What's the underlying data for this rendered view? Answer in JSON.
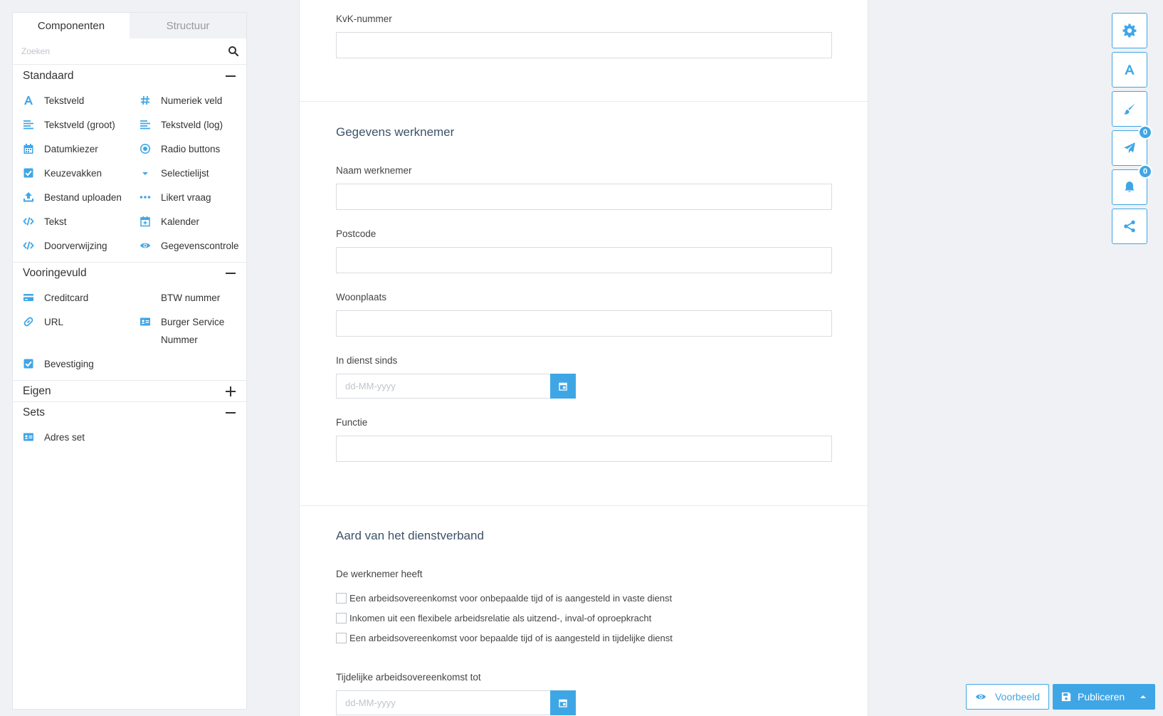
{
  "sidebar": {
    "tabs": [
      {
        "label": "Componenten",
        "active": true
      },
      {
        "label": "Structuur",
        "active": false
      }
    ],
    "search_placeholder": "Zoeken",
    "sections": {
      "standaard": {
        "title": "Standaard",
        "items": [
          {
            "label": "Tekstveld",
            "icon": "font-icon"
          },
          {
            "label": "Numeriek veld",
            "icon": "hash-icon"
          },
          {
            "label": "Tekstveld (groot)",
            "icon": "align-left-icon"
          },
          {
            "label": "Tekstveld (log)",
            "icon": "align-left-icon"
          },
          {
            "label": "Datumkiezer",
            "icon": "calendar-icon"
          },
          {
            "label": "Radio buttons",
            "icon": "radio-icon"
          },
          {
            "label": "Keuzevakken",
            "icon": "checkbox-icon"
          },
          {
            "label": "Selectielijst",
            "icon": "caret-down-icon"
          },
          {
            "label": "Bestand uploaden",
            "icon": "upload-icon"
          },
          {
            "label": "Likert vraag",
            "icon": "ellipsis-icon"
          },
          {
            "label": "Tekst",
            "icon": "code-icon"
          },
          {
            "label": "Kalender",
            "icon": "calendar-plus-icon"
          },
          {
            "label": "Doorverwijzing",
            "icon": "code-icon"
          },
          {
            "label": "Gegevenscontrole",
            "icon": "eye-icon"
          }
        ]
      },
      "vooringevuld": {
        "title": "Vooringevuld",
        "items": [
          {
            "label": "Creditcard",
            "icon": "credit-card-icon"
          },
          {
            "label": "BTW nummer",
            "icon": ""
          },
          {
            "label": "URL",
            "icon": "link-icon"
          },
          {
            "label": "Burger Service Nummer",
            "icon": "id-card-icon"
          },
          {
            "label": "Bevestiging",
            "icon": "checkbox-icon"
          }
        ]
      },
      "eigen": {
        "title": "Eigen"
      },
      "sets": {
        "title": "Sets",
        "items": [
          {
            "label": "Adres set",
            "icon": "id-card-icon"
          }
        ]
      }
    }
  },
  "form": {
    "kvk_label": "KvK-nummer",
    "section_werknemer": "Gegevens werknemer",
    "naam_label": "Naam werknemer",
    "postcode_label": "Postcode",
    "woonplaats_label": "Woonplaats",
    "in_dienst_label": "In dienst sinds",
    "date_placeholder": "dd-MM-yyyy",
    "functie_label": "Functie",
    "section_dienstverband": "Aard van het dienstverband",
    "werknemer_heeft_label": "De werknemer heeft",
    "options": [
      "Een arbeidsovereenkomst voor onbepaalde tijd of is aangesteld in vaste dienst",
      "Inkomen uit een flexibele arbeidsrelatie als uitzend-, inval-of oproepkracht",
      "Een arbeidsovereenkomst voor bepaalde tijd of is aangesteld in tijdelijke dienst"
    ],
    "tijdelijk_label": "Tijdelijke arbeidsovereenkomst tot"
  },
  "toolbar": {
    "send_badge": "0",
    "notify_badge": "0"
  },
  "actions": {
    "preview_label": "Voorbeeld",
    "publish_label": "Publiceren"
  },
  "colors": {
    "accent": "#3fa6e6",
    "heading": "#3e5268"
  }
}
